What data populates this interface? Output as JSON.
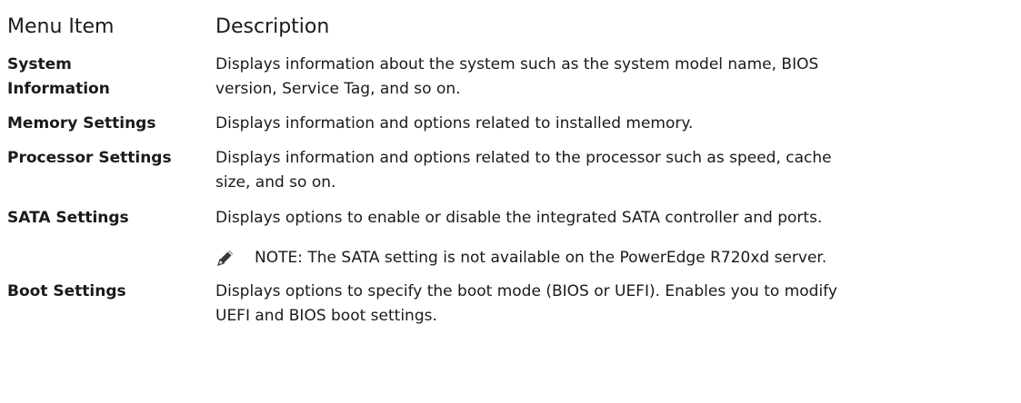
{
  "header": {
    "menu_item": "Menu Item",
    "description": "Description"
  },
  "rows": [
    {
      "item": "System Information",
      "item_line1": "System",
      "item_line2": "Information",
      "desc_line1": "Displays information about the system such as the system model name, BIOS",
      "desc_line2": "version, Service Tag, and so on."
    },
    {
      "item": "Memory Settings",
      "desc_line1": "Displays information and options related to installed memory."
    },
    {
      "item": "Processor Settings",
      "desc_line1": "Displays information and options related to the processor such as speed, cache",
      "desc_line2": "size, and so on."
    },
    {
      "item": "SATA Settings",
      "desc_line1": "Displays options to enable or disable the integrated SATA controller and ports.",
      "note": {
        "icon": "note-pencil-icon",
        "label": "NOTE:",
        "text": " The SATA setting is not available on the PowerEdge R720xd server."
      }
    },
    {
      "item": "Boot Settings",
      "desc_line1": "Displays options to specify the boot mode (BIOS or UEFI). Enables you to modify",
      "desc_line2": "UEFI and BIOS boot settings."
    }
  ]
}
